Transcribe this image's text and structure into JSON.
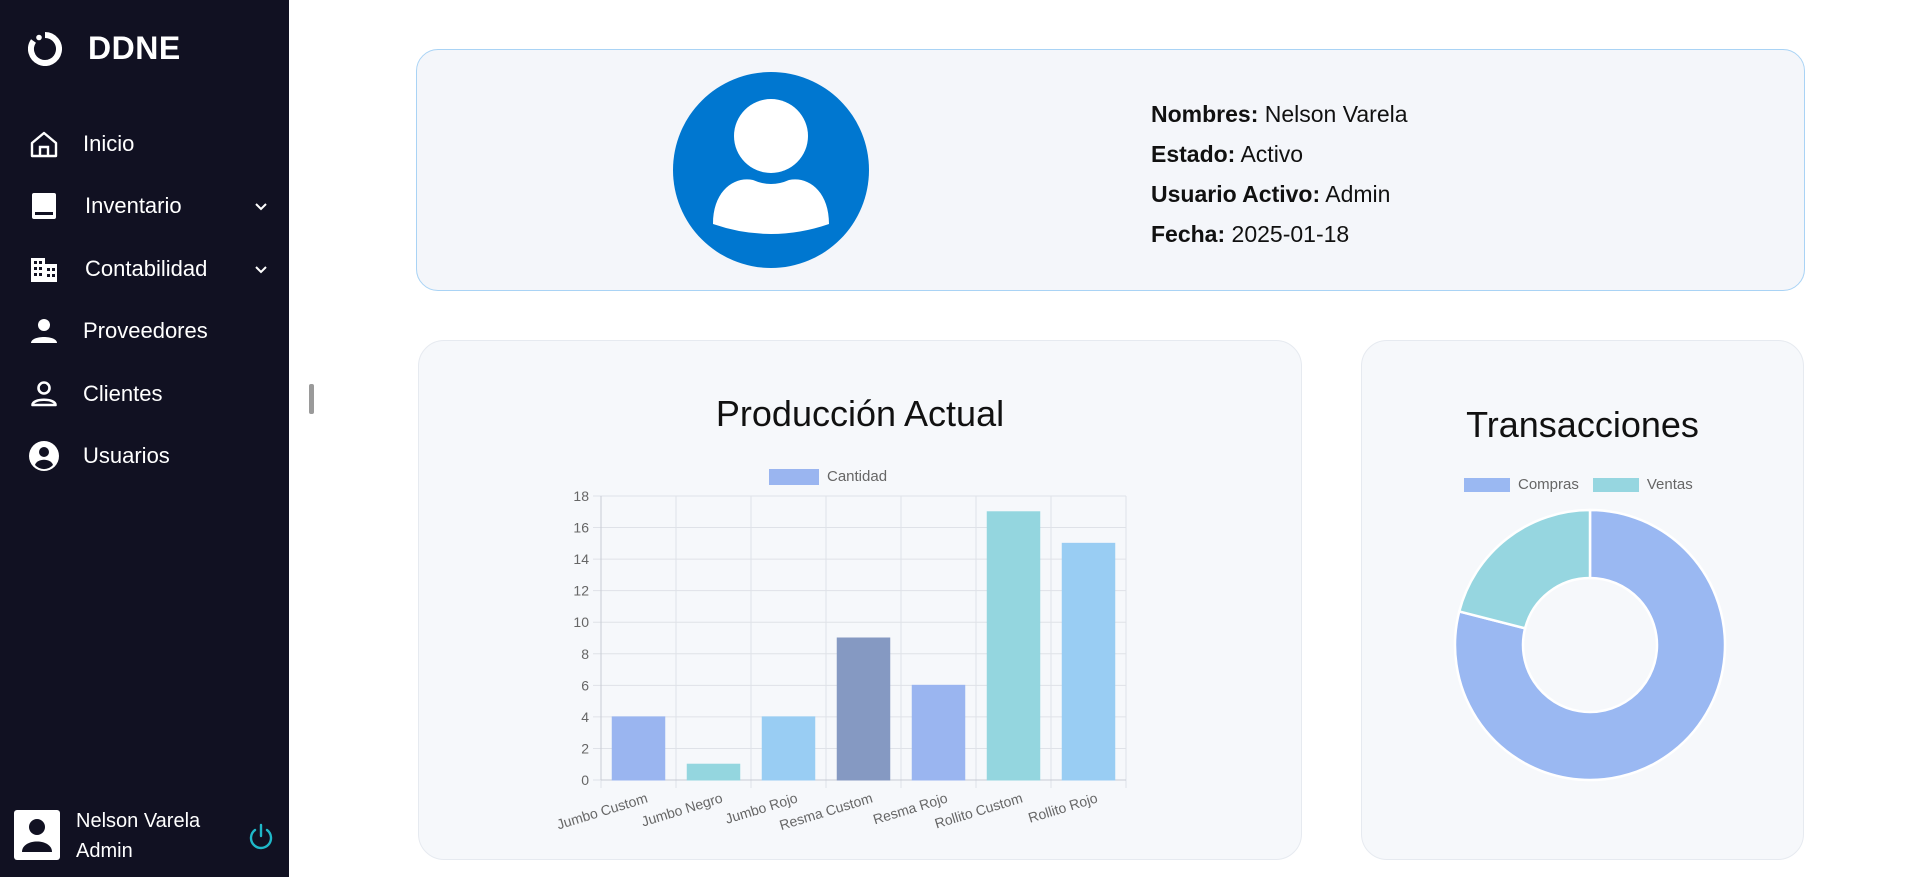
{
  "brand": {
    "name": "DDNE"
  },
  "nav": [
    {
      "label": "Inicio",
      "icon": "home-icon",
      "has_submenu": false
    },
    {
      "label": "Inventario",
      "icon": "book-icon",
      "has_submenu": true
    },
    {
      "label": "Contabilidad",
      "icon": "building-icon",
      "has_submenu": true
    },
    {
      "label": "Proveedores",
      "icon": "person-icon",
      "has_submenu": false
    },
    {
      "label": "Clientes",
      "icon": "person-outline-icon",
      "has_submenu": false
    },
    {
      "label": "Usuarios",
      "icon": "account-circle-icon",
      "has_submenu": false
    }
  ],
  "user": {
    "name": "Nelson Varela",
    "role": "Admin"
  },
  "profile": {
    "nombres_label": "Nombres:",
    "nombres": "Nelson Varela",
    "estado_label": "Estado:",
    "estado": "Activo",
    "usuario_label": "Usuario Activo:",
    "usuario": "Admin",
    "fecha_label": "Fecha:",
    "fecha": "2025-01-18"
  },
  "colors": {
    "sidebar_bg": "#111122",
    "avatar_blue": "#0077d0",
    "power": "#1fb8c9"
  },
  "chart_data": [
    {
      "type": "bar",
      "title": "Producción Actual",
      "categories": [
        "Jumbo Custom",
        "Jumbo Negro",
        "Jumbo Rojo",
        "Resma Custom",
        "Resma Rojo",
        "Rollito Custom",
        "Rollito Rojo"
      ],
      "series": [
        {
          "name": "Cantidad",
          "values": [
            4,
            1,
            4,
            9,
            6,
            17,
            15
          ]
        }
      ],
      "bar_colors": [
        "#9ab5f0",
        "#94d6df",
        "#99cdf3",
        "#8599c2",
        "#9ab5f0",
        "#94d6df",
        "#99cdf3"
      ],
      "ylim": [
        0,
        18
      ],
      "yticks": [
        0,
        2,
        4,
        6,
        8,
        10,
        12,
        14,
        16,
        18
      ],
      "grid": true,
      "legend": "top"
    },
    {
      "type": "pie",
      "title": "Transacciones",
      "labels": [
        "Compras",
        "Ventas"
      ],
      "values": [
        79,
        21
      ],
      "colors": [
        "#9ab8f2",
        "#96d6e0"
      ],
      "legend": "top"
    }
  ]
}
